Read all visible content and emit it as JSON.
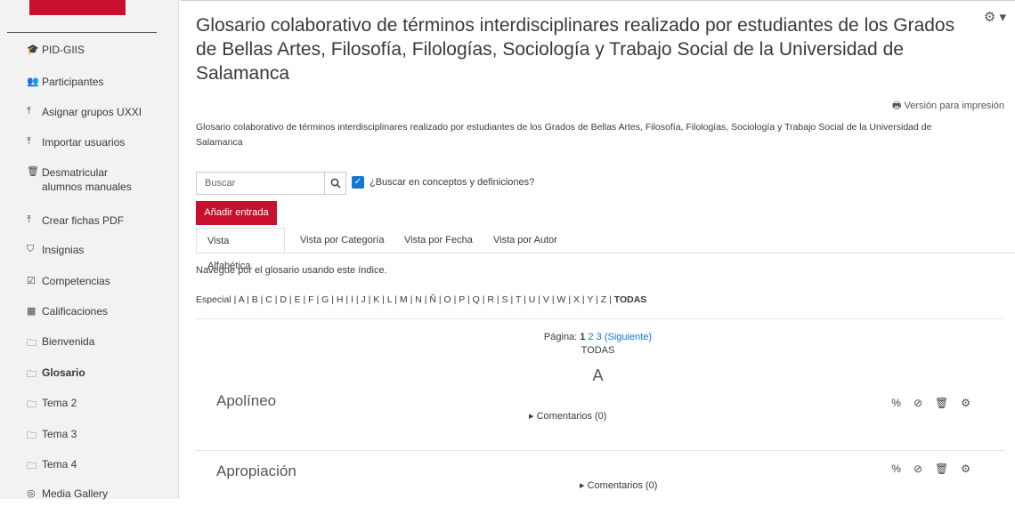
{
  "sidebar": {
    "items": [
      {
        "label": "PID-GIIS",
        "icon": "graduation-cap-icon",
        "glyph": "🎓",
        "bold": false
      },
      {
        "label": "Participantes",
        "icon": "users-icon",
        "glyph": "👥",
        "bold": false
      },
      {
        "label": "Asignar grupos UXXI",
        "icon": "upload-icon",
        "glyph": "⤒",
        "bold": false
      },
      {
        "label": "Importar usuarios",
        "icon": "upload-icon",
        "glyph": "⤒",
        "bold": false
      },
      {
        "label": "Desmatricular alumnos manuales",
        "icon": "trash-icon",
        "glyph": "🗑",
        "bold": false
      },
      {
        "label": "Crear fichas PDF",
        "icon": "upload-icon",
        "glyph": "⤒",
        "bold": false
      },
      {
        "label": "Insignias",
        "icon": "shield-icon",
        "glyph": "⛉",
        "bold": false
      },
      {
        "label": "Competencias",
        "icon": "checkbox-icon",
        "glyph": "☑",
        "bold": false
      },
      {
        "label": "Calificaciones",
        "icon": "table-icon",
        "glyph": "▦",
        "bold": false
      },
      {
        "label": "Bienvenida",
        "icon": "folder-icon",
        "glyph": "🗀",
        "bold": false
      },
      {
        "label": "Glosario",
        "icon": "folder-icon",
        "glyph": "🗀",
        "bold": true
      },
      {
        "label": "Tema 2",
        "icon": "folder-icon",
        "glyph": "🗀",
        "bold": false
      },
      {
        "label": "Tema 3",
        "icon": "folder-icon",
        "glyph": "🗀",
        "bold": false
      },
      {
        "label": "Tema 4",
        "icon": "folder-icon",
        "glyph": "🗀",
        "bold": false
      },
      {
        "label": "Media Gallery",
        "icon": "gallery-icon",
        "glyph": "◎",
        "bold": false
      }
    ]
  },
  "main": {
    "title": "Glosario colaborativo de términos interdisciplinares realizado por estudiantes de los Grados de Bellas Artes, Filosofía, Filologías, Sociología y Trabajo Social de la Universidad de Salamanca",
    "print_label": "Versión para impresión",
    "description": "Glosario colaborativo de términos interdisciplinares realizado por estudiantes de los Grados de Bellas Artes, Filosofía, Filologías, Sociología y Trabajo Social de la Universidad de Salamanca",
    "search": {
      "placeholder": "Buscar",
      "checkbox_label": "¿Buscar en conceptos y definiciones?",
      "checked": true
    },
    "add_entry_label": "Añadir entrada",
    "tabs": [
      {
        "label": "Vista Alfabética",
        "active": true
      },
      {
        "label": "Vista por Categoría",
        "active": false
      },
      {
        "label": "Vista por Fecha",
        "active": false
      },
      {
        "label": "Vista por Autor",
        "active": false
      }
    ],
    "nav_text": "Navegue por el glosario usando este índice.",
    "alphabet": [
      "Especial",
      "A",
      "B",
      "C",
      "D",
      "E",
      "F",
      "G",
      "H",
      "I",
      "J",
      "K",
      "L",
      "M",
      "N",
      "Ñ",
      "O",
      "P",
      "Q",
      "R",
      "S",
      "T",
      "U",
      "V",
      "W",
      "X",
      "Y",
      "Z"
    ],
    "alphabet_all": "TODAS",
    "pager": {
      "label": "Página:",
      "current": "1",
      "pages": [
        "2",
        "3"
      ],
      "next": "(Siguiente)",
      "all": "TODAS"
    },
    "letter": "A",
    "entries": [
      {
        "title": "Apolíneo",
        "comments": "Comentarios (0)"
      },
      {
        "title": "Apropiación",
        "comments": "Comentarios (0)"
      }
    ]
  },
  "colors": {
    "brand_red": "#c8102e",
    "link_blue": "#1177d1"
  }
}
